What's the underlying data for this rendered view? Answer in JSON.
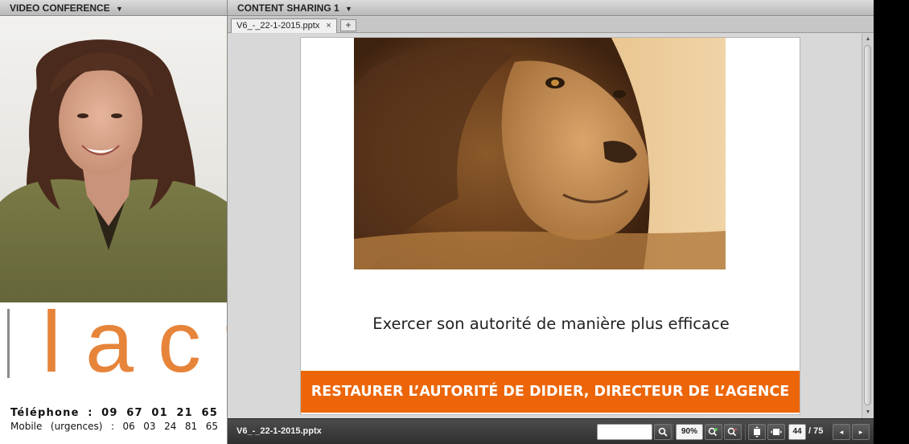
{
  "video_conference": {
    "header": "VIDEO CONFERENCE",
    "caret": "▼",
    "logo": "lact",
    "contact": {
      "phone_label": "Téléphone",
      "phone_sep": ":",
      "phone_parts": [
        "09",
        "67",
        "01",
        "21",
        "65"
      ],
      "mobile_label": "Mobile",
      "mobile_note": "(urgences)",
      "mobile_sep": ":",
      "mobile_parts": [
        "06",
        "03",
        "24",
        "81",
        "65"
      ]
    }
  },
  "content_sharing": {
    "header": "CONTENT SHARING 1",
    "caret": "▼",
    "tab": {
      "label": "V6_-_22-1-2015.pptx",
      "close": "×"
    },
    "add_tab": "+",
    "slide": {
      "subtitle": "Exercer son autorité de manière plus efficace",
      "banner": "RESTAURER L’AUTORITÉ DE DIDIER, DIRECTEUR DE L’AGENCE"
    },
    "toolbar": {
      "filename": "V6_-_22-1-2015.pptx",
      "search_placeholder": "",
      "zoom": "90%",
      "page_current": "44",
      "page_total": "/ 75"
    }
  },
  "colors": {
    "banner": "#ec6609",
    "logo": "#e6843a"
  },
  "icons": [
    "search-icon",
    "zoom-in-icon",
    "zoom-out-icon",
    "fit-page-icon",
    "fit-width-icon",
    "prev-page-icon",
    "next-page-icon",
    "scroll-up-icon",
    "scroll-down-icon"
  ]
}
